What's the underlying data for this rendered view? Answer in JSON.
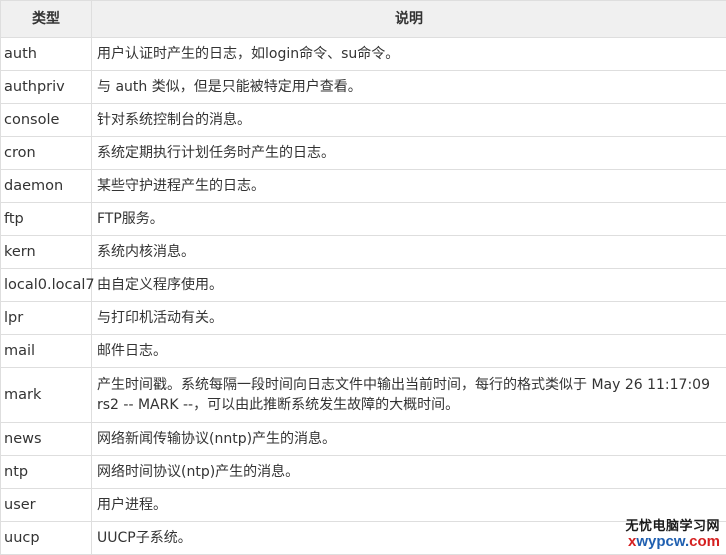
{
  "table": {
    "headers": [
      "类型",
      "说明"
    ],
    "rows": [
      {
        "type": "auth",
        "desc": "用户认证时产生的日志，如login命令、su命令。"
      },
      {
        "type": "authpriv",
        "desc": "与 auth 类似，但是只能被特定用户查看。"
      },
      {
        "type": "console",
        "desc": "针对系统控制台的消息。"
      },
      {
        "type": "cron",
        "desc": "系统定期执行计划任务时产生的日志。"
      },
      {
        "type": "daemon",
        "desc": "某些守护进程产生的日志。"
      },
      {
        "type": "ftp",
        "desc": "FTP服务。"
      },
      {
        "type": "kern",
        "desc": "系统内核消息。"
      },
      {
        "type": "local0.local7",
        "desc": "由自定义程序使用。"
      },
      {
        "type": "lpr",
        "desc": "与打印机活动有关。"
      },
      {
        "type": "mail",
        "desc": "邮件日志。"
      },
      {
        "type": "mark",
        "desc": "产生时间戳。系统每隔一段时间向日志文件中输出当前时间，每行的格式类似于 May 26 11:17:09 rs2 -- MARK --，可以由此推断系统发生故障的大概时间。"
      },
      {
        "type": "news",
        "desc": "网络新闻传输协议(nntp)产生的消息。"
      },
      {
        "type": "ntp",
        "desc": "网络时间协议(ntp)产生的消息。"
      },
      {
        "type": "user",
        "desc": "用户进程。"
      },
      {
        "type": "uucp",
        "desc": "UUCP子系统。"
      }
    ]
  },
  "watermark": {
    "line1": "无忧电脑学习网",
    "line2_prefix": "x",
    "line2_main": "wypcw.",
    "line2_suffix": "com"
  }
}
